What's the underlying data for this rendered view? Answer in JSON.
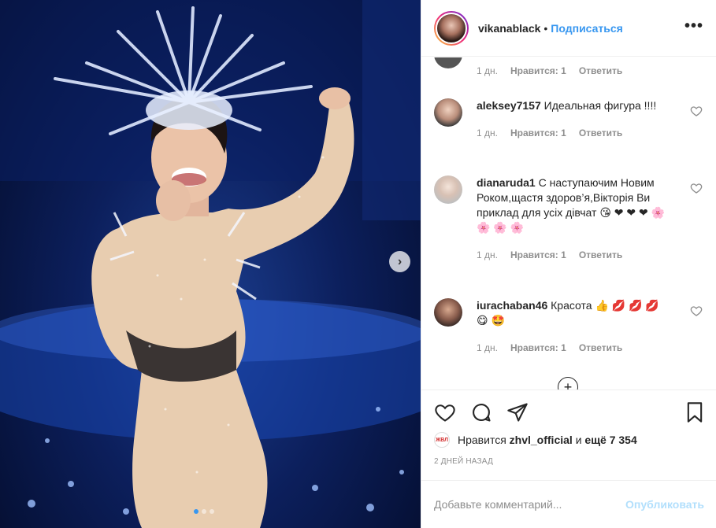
{
  "header": {
    "username": "vikanablack",
    "separator": "•",
    "follow_label": "Подписаться",
    "more_label": "•••"
  },
  "comments": [
    {
      "username": "",
      "text": "",
      "time": "1 дн.",
      "likes": "Нравится: 1",
      "reply": "Ответить"
    },
    {
      "username": "aleksey7157",
      "text": "Идеальная фигура !!!!",
      "time": "1 дн.",
      "likes": "Нравится: 1",
      "reply": "Ответить"
    },
    {
      "username": "dianaruda1",
      "text": "С наступаючим Новим Роком,щастя здоров’я,Вікторія Ви приклад для усіх дівчат",
      "emojis": "😘 ❤ ❤ ❤ 🌸 🌸 🌸 🌸",
      "time": "1 дн.",
      "likes": "Нравится: 1",
      "reply": "Ответить"
    },
    {
      "username": "iurachaban46",
      "text": "Красота",
      "emojis": "👍 💋 💋 💋 😋 🤩",
      "time": "1 дн.",
      "likes": "Нравится: 1",
      "reply": "Ответить"
    }
  ],
  "likes": {
    "badge": "ЖВЛ",
    "prefix": "Нравится",
    "user": "zhvl_official",
    "middle": "и",
    "count": "ещё 7 354"
  },
  "timestamp": "2 ДНЕЙ НАЗАД",
  "add_comment": {
    "placeholder": "Добавьте комментарий...",
    "publish_label": "Опубликовать"
  },
  "colors": {
    "accent": "#3897f0",
    "publish_disabled": "#b2dffc",
    "muted": "#8e8e8e"
  }
}
